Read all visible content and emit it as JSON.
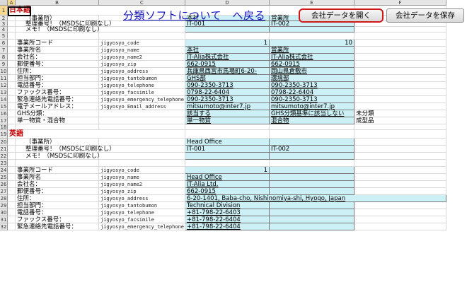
{
  "columns": [
    {
      "letter": "A",
      "width": 11,
      "selected": true
    },
    {
      "letter": "B",
      "width": 118,
      "selected": false
    },
    {
      "letter": "C",
      "width": 122,
      "selected": false
    },
    {
      "letter": "D",
      "width": 119,
      "selected": false
    },
    {
      "letter": "E",
      "width": 120,
      "selected": false
    },
    {
      "letter": "F",
      "width": 130,
      "selected": false
    }
  ],
  "header_link": "分類ソフトについて　へ戻る",
  "buttons": {
    "open_label": "会社データを開く",
    "save_label": "会社データを保存"
  },
  "rows": [
    {
      "n": "1",
      "h": 14,
      "sel": true,
      "sec": "日本語"
    },
    {
      "n": "2",
      "h": 8,
      "label": "（事業所）",
      "indent": true,
      "d": "本社",
      "e": "営業所",
      "teal": true
    },
    {
      "n": "3",
      "h": 8,
      "label": "整理番号！（MSDSに印刷なし）",
      "indent": true,
      "d": "IT-001",
      "e": "IT-002",
      "teal": true
    },
    {
      "n": "4",
      "h": 8,
      "label": "メモ！（MSDSに印刷なし）",
      "indent": true,
      "teal": true
    },
    {
      "n": "5",
      "h": 10
    },
    {
      "n": "6",
      "h": 10,
      "label": "事業所コード",
      "code": "jigyosyo_code",
      "d": "1",
      "e": "10",
      "num": true,
      "teal": true
    },
    {
      "n": "7",
      "h": 10,
      "label": "事業所名",
      "code": "jigyosyo_name",
      "d": "本社",
      "e": "営業所",
      "teal": true,
      "ul": true
    },
    {
      "n": "8",
      "h": 10,
      "label": "会社名：",
      "code": "jigyosyo_name2",
      "d": "IT-Alia株式会社",
      "e": "IT-Alia株式会社",
      "teal": true,
      "ul": true
    },
    {
      "n": "9",
      "h": 10,
      "label": "郵便番号：",
      "code": "jigyosyo_zip",
      "d": "662-0915",
      "e": "662-0915",
      "teal": true,
      "ul": true
    },
    {
      "n": "10",
      "h": 10,
      "label": "住所：",
      "code": "jigyosyo_address",
      "d": "兵庫県西宮市馬場町6-20-",
      "e": "岡山県倉敷市",
      "teal": true,
      "ul": true
    },
    {
      "n": "11",
      "h": 10,
      "label": "担当部門：",
      "code": "jigyosyo_tantobumon",
      "d": "GHS部",
      "e": "環境部",
      "teal": true,
      "ul": true
    },
    {
      "n": "12",
      "h": 10,
      "label": "電話番号：",
      "code": "jigyosyo_telephone",
      "d": "090-2350-3713",
      "e": "090-2350-3713",
      "teal": true,
      "ul": true
    },
    {
      "n": "13",
      "h": 10,
      "label": "ファックス番号：",
      "code": "jigyosyo_facsimile",
      "d": "0798-22-6404",
      "e": "0798-22-6404",
      "teal": true,
      "ul": true
    },
    {
      "n": "14",
      "h": 10,
      "label": "緊急連絡先電話番号：",
      "code": "jigyosyo_emergency_telephone",
      "d": "090-2350-3713",
      "e": "090-2350-3713",
      "teal": true,
      "ul": true
    },
    {
      "n": "15",
      "h": 10,
      "label": "電子メールアドレス：",
      "code": "jigyosyo_Email_address",
      "d": "mitsumoto@inter7.jp",
      "e": "mitsumoto@inter7.jp",
      "teal": true,
      "ul": true
    },
    {
      "n": "16",
      "h": 10,
      "label": "GHS分類：",
      "d": "該当する",
      "e": "GHS分類基準に該当しない",
      "f": "未分類",
      "teal": true,
      "ul": true
    },
    {
      "n": "17",
      "h": 10,
      "label": "単一物質・混合物",
      "d": "単一物質",
      "e": "混合物",
      "f": "成型品",
      "teal": true,
      "ul": true
    },
    {
      "n": "18",
      "h": 8
    },
    {
      "n": "19",
      "h": 12,
      "sec": "英語"
    },
    {
      "n": "20",
      "h": 10,
      "label": "（事業所）",
      "indent": true,
      "d": "Head Office",
      "teal": true
    },
    {
      "n": "21",
      "h": 10,
      "label": "整理番号！（MSDSに印刷なし）",
      "indent": true,
      "d": "IT-001",
      "e": "IT-002",
      "teal": true
    },
    {
      "n": "22",
      "h": 10,
      "label": "メモ！（MSDSに印刷なし）",
      "indent": true,
      "teal": true
    },
    {
      "n": "23",
      "h": 10
    },
    {
      "n": "24",
      "h": 10,
      "label": "事業所コード",
      "code": "jigyosyo_code",
      "d": "1",
      "num": true,
      "teal": true
    },
    {
      "n": "25",
      "h": 10,
      "label": "事業所名",
      "code": "jigyosyo_name",
      "d": "Head Office",
      "teal": true,
      "ul": true
    },
    {
      "n": "26",
      "h": 10,
      "label": "会社名：",
      "code": "jigyosyo_name2",
      "d": "IT-Alia Ltd.",
      "teal": true,
      "ul": true
    },
    {
      "n": "27",
      "h": 10,
      "label": "郵便番号：",
      "code": "jigyosyo_zip",
      "d": "662-0915",
      "teal": true,
      "ul": true
    },
    {
      "n": "28",
      "h": 10,
      "label": "住所：",
      "code": "jigyosyo_address",
      "d": "6-20-1401, Baba-cho, Nishinomiya-shi, Hyogo, Japan",
      "teal": true,
      "ul": true,
      "span": true
    },
    {
      "n": "29",
      "h": 10,
      "label": "担当部門：",
      "code": "jigyosyo_tantobumon",
      "d": "Technical Division",
      "teal": true,
      "ul": true
    },
    {
      "n": "30",
      "h": 10,
      "label": "電話番号：",
      "code": "jigyosyo_telephone",
      "d": "+81-798-22-6403",
      "teal": true,
      "ul": true
    },
    {
      "n": "31",
      "h": 10,
      "label": "ファックス番号：",
      "code": "jigyosyo_facsimile",
      "d": "+81-798-22-6404",
      "teal": true,
      "ul": true
    },
    {
      "n": "32",
      "h": 10,
      "label": "緊急連絡先電話番号：",
      "code": "jigyosyo_emergency_telephone",
      "d": "+81-798-22-6404",
      "teal": true,
      "ul": true
    }
  ]
}
